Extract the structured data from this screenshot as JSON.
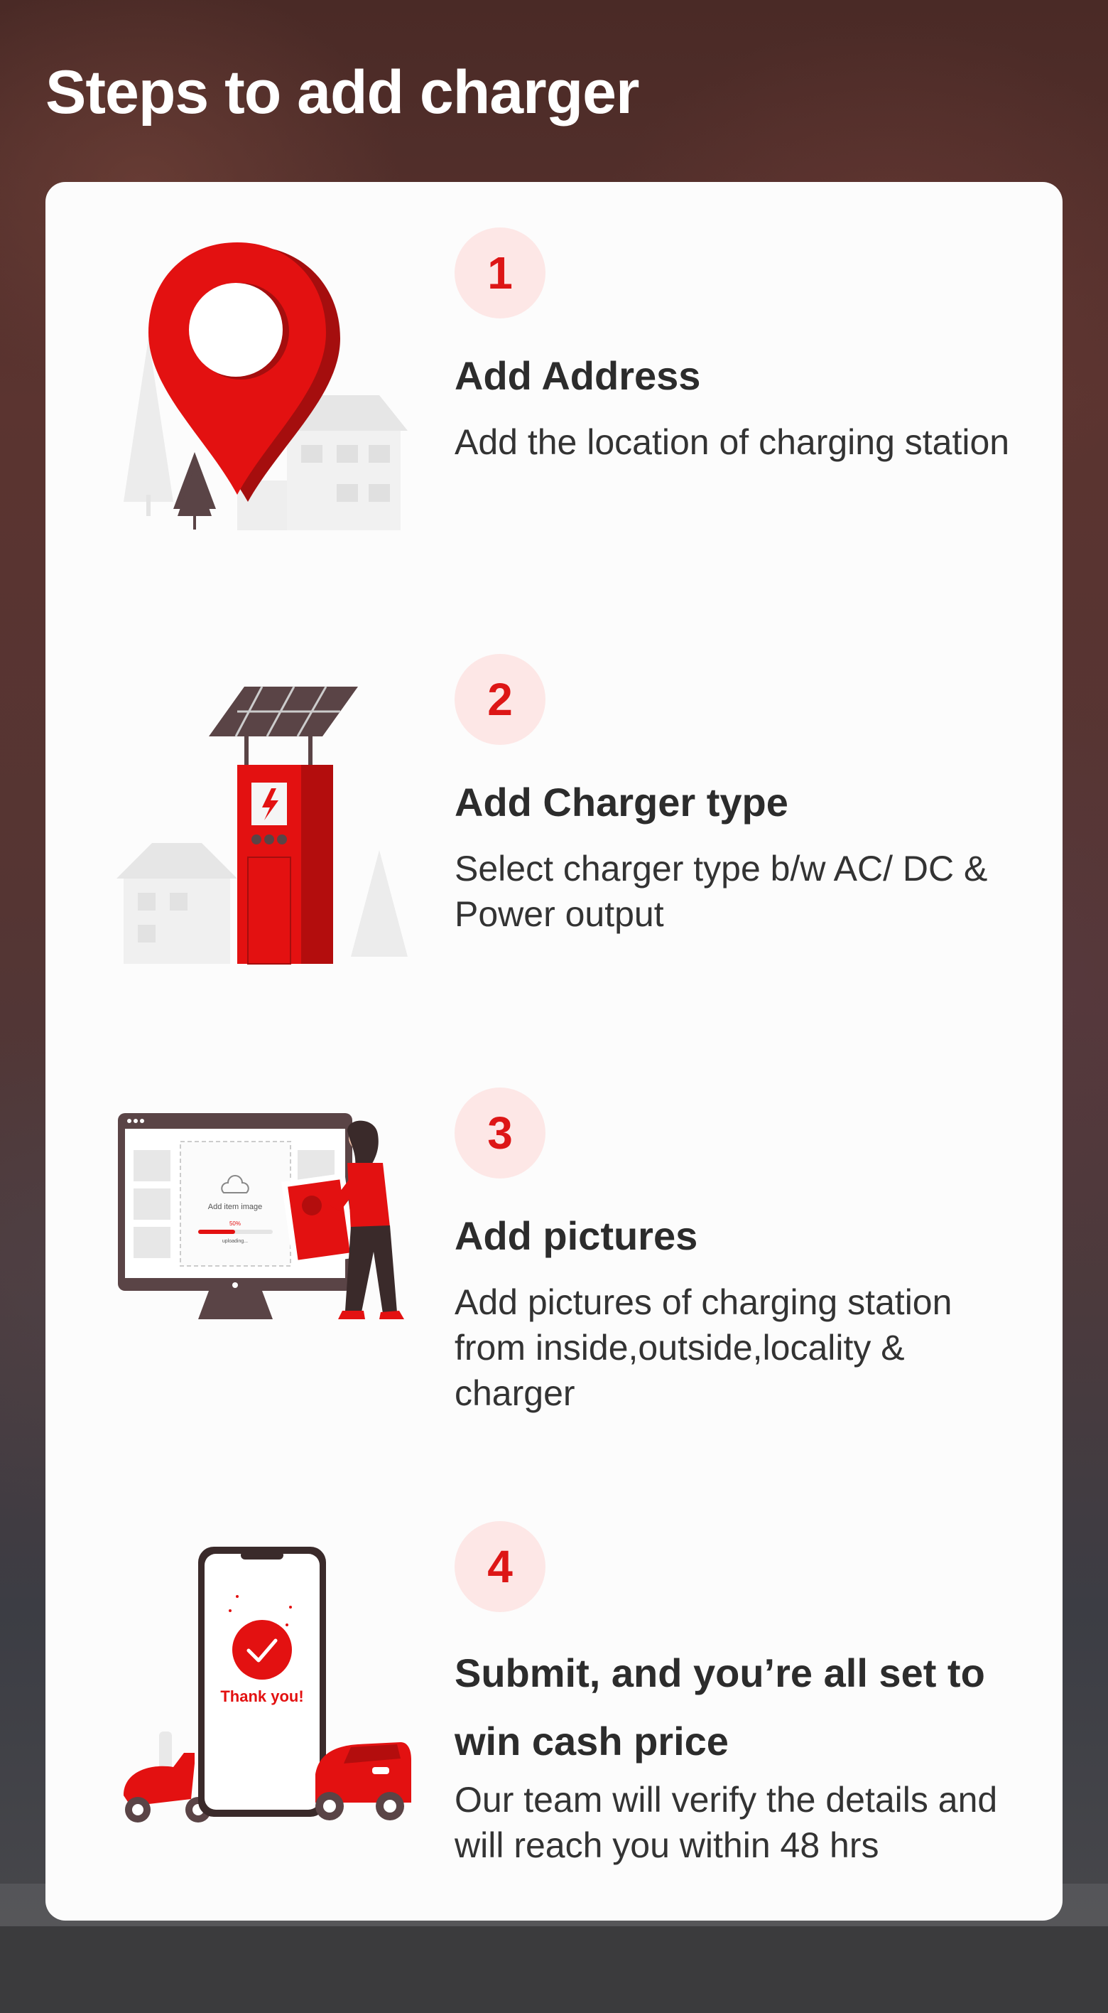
{
  "page": {
    "title": "Steps to add charger"
  },
  "steps": [
    {
      "number": "1",
      "title": "Add Address",
      "description": "Add the location of charging station",
      "illustration": "map-pin-illustration"
    },
    {
      "number": "2",
      "title": "Add Charger type",
      "description": "Select charger type b/w AC/ DC & Power output",
      "illustration": "charging-station-illustration"
    },
    {
      "number": "3",
      "title": "Add pictures",
      "description": "Add pictures of charging station from inside,outside,locality & charger",
      "illustration": "upload-pictures-illustration",
      "illustration_text": {
        "upload_label": "Add item image",
        "progress_label": "50%",
        "progress_status": "uploading..."
      }
    },
    {
      "number": "4",
      "title": "Submit, and you’re all set to win cash price",
      "description": "Our team will verify the details and will reach you within 48 hrs",
      "illustration": "phone-thank-you-illustration",
      "illustration_text": {
        "thank_you": "Thank you!"
      }
    }
  ],
  "colors": {
    "accent": "#DD1616",
    "badge_bg": "#FDE7E6",
    "card_bg": "#FCFCFC",
    "text_dark": "#2C2C2C",
    "illustration_brown": "#5A4446"
  }
}
